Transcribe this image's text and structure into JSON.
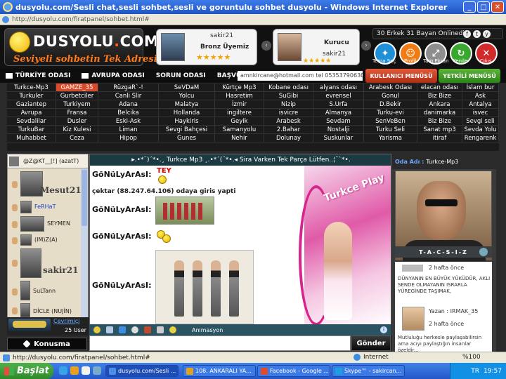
{
  "window": {
    "title": "dusyolu.com/Sesli chat,sesli sohbet,sesli ve goruntulu sohbet dusyolu - Windows Internet Explorer",
    "address": "http://dusyolu.com/firatpanel/sohbet.html#",
    "min": "_",
    "max": "□",
    "close": "✕"
  },
  "header": {
    "logo_main": "DUSYOLU",
    "logo_dot": ".",
    "logo_tld": "COM",
    "logo_tagline": "Seviyeli sohbetin Tek Adresi",
    "online_text": "30 Erkek 31 Bayan Onlinedir",
    "social": [
      "f",
      "t",
      "y"
    ],
    "cards": [
      {
        "name": "sakir21",
        "rank": "Bronz Üyemiz",
        "stars": "★★★★★"
      },
      {
        "name": "sakir21",
        "rank": "Kurucu",
        "stars": "★★★★★"
      }
    ],
    "arrows": [
      "‹",
      "›"
    ],
    "round_buttons": [
      {
        "label": "Tema Seç",
        "glyph": "✦",
        "color": "#1f8fd8"
      },
      {
        "label": "Profil",
        "glyph": "☺",
        "color": "#f07c16"
      },
      {
        "label": "Tam Ekran",
        "glyph": "⤢",
        "color": "#8e8e8e"
      },
      {
        "label": "Yenile",
        "glyph": "↻",
        "color": "#3aa82e"
      },
      {
        "label": "Çıkış",
        "glyph": "✕",
        "color": "#d22a2a"
      }
    ]
  },
  "menu": {
    "items": [
      "TÜRKİYE ODASI",
      "AVRUPA ODASI",
      "SORUN ODASI",
      "BAŞVURU ODASI"
    ],
    "email_text": "amnkircane@hotmail.com tel 05353790630",
    "user_menu": "KULLANICI MENÜSÜ",
    "authorized_menu": "YETKİLİ MENÜSÜ"
  },
  "rooms": {
    "highlighted": "GAMZE_35",
    "rows": [
      [
        "Turkce-Mp3",
        "GAMZE_35",
        "RüzgaR`-!",
        "SeVDaM",
        "Kürtçe Mp3",
        "Kobane odası",
        "alyans odası",
        "Arabesk Odası",
        "elacan odası",
        "İslam bur"
      ],
      [
        "Turkuler",
        "Gurbetciler",
        "Canli Slir",
        "Yolcu",
        "Hasretim",
        "SuGibi",
        "evrensel",
        "Gonul",
        "Biz Bize",
        "Ask"
      ],
      [
        "Gaziantep",
        "Turkiyem",
        "Adana",
        "Malatya",
        "İzmir",
        "Nizip",
        "S.Urfa",
        "D.Bekir",
        "Ankara",
        "Antalya"
      ],
      [
        "Avrupa",
        "Fransa",
        "Belcika",
        "Hollanda",
        "ingiltere",
        "isvicre",
        "Almanya",
        "Turku-evi",
        "danimarka",
        "isvec"
      ],
      [
        "Sevdalilar",
        "Dusler",
        "Eski-Ask",
        "Haykiris",
        "Geyik",
        "Arabesk",
        "Sevdam",
        "SenVeBen",
        "Biz Bize",
        "Sevgi seli"
      ],
      [
        "TurkuBar",
        "Kiz Kulesi",
        "Liman",
        "Sevgi Bahçesi",
        "Samanyolu",
        "2.Bahar",
        "Nostalji",
        "Turku Seli",
        "Sanat mp3",
        "Sevda Yolu"
      ],
      [
        "Muhabbet",
        "Ceza",
        "Hipop",
        "Gunes",
        "Nehir",
        "Dolunay",
        "Suskunlar",
        "Yarisma",
        "itiraf",
        "Rengarenk"
      ]
    ]
  },
  "users": {
    "header": "@Z@KT__[!] (azatT)",
    "list": [
      {
        "name": "",
        "big": "Mesut21"
      },
      {
        "name": "FeRHaT",
        "big": ""
      },
      {
        "name": "SEYMEN",
        "big": ""
      },
      {
        "name": "(IM)Z(A)",
        "big": ""
      },
      {
        "name": "",
        "big": "sakir21"
      },
      {
        "name": "SuLTann",
        "big": ""
      },
      {
        "name": "DİCLE (NUJİN)",
        "big": ""
      }
    ],
    "online_link": "Çevrimiçi",
    "user_count": "25 User",
    "talk_button": "Konusma"
  },
  "chat": {
    "header": "▸.•*¨)´*•.¸ Turkce Mp3 ¸.•*´(¨*•.◂ Sira Varken Tek Parça Lütfen..¦¨`*•.",
    "sender": "GöNüLyArAsI:",
    "tey": "TEY",
    "system_message": "çektar (88.247.64.106) odaya giris yapti",
    "banner_text": "Turkce Play",
    "toolbar_label": "Animasyon",
    "info": "i",
    "send_button": "Gönder"
  },
  "room_panel": {
    "label": "Oda Adı :",
    "value": "Turkce-Mp3",
    "cam_name": "T-A-C-S-I-Z",
    "feed": [
      {
        "time": "2 hafta önce",
        "text": "DÜNYANIN EN BÜYÜK YÜKÜDÜR,  AKLI SENDE OLMAYANIN ISRARLA YÜREGİNDE TAŞIMAK,"
      },
      {
        "author": "Yazan : IRMAK_35",
        "time": "2 hafta önce",
        "text": "Mutluluğu herkesle paylaşabilirsin ama acıyı paylaştığın insanlar özeldir..."
      }
    ]
  },
  "status": {
    "url": "http://dusyolu.com/firatpanel/sohbet.html#",
    "zone": "Internet",
    "zoom": "%100"
  },
  "taskbar": {
    "start": "Başlat",
    "tasks": [
      {
        "label": "dusyolu.com/Sesli ...",
        "color": "#4b8fe6",
        "active": true
      },
      {
        "label": "108. ANKARALI YA...",
        "color": "#e0a020",
        "active": false
      },
      {
        "label": "Facebook - Google ...",
        "color": "#e04a2a",
        "active": false
      },
      {
        "label": "Skype™ - sakircan...",
        "color": "#1aa0e0",
        "active": false
      }
    ],
    "lang": "TR",
    "clock": "19:57"
  }
}
